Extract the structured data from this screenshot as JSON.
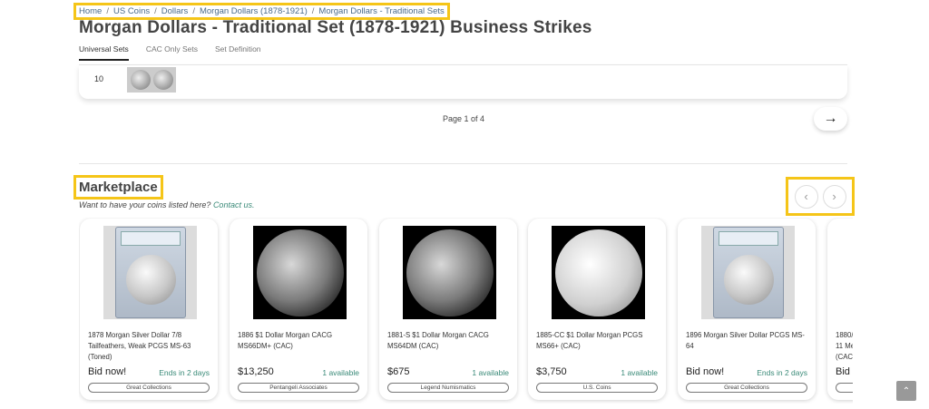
{
  "breadcrumb": [
    "Home",
    "US Coins",
    "Dollars",
    "Morgan Dollars (1878-1921)",
    "Morgan Dollars - Traditional Sets"
  ],
  "breadcrumb_sep": "/",
  "page_title": "Morgan Dollars - Traditional Set (1878-1921) Business Strikes",
  "tabs": [
    {
      "label": "Universal Sets",
      "active": true
    },
    {
      "label": "CAC Only Sets",
      "active": false
    },
    {
      "label": "Set Definition",
      "active": false
    }
  ],
  "table_row": {
    "number": "10"
  },
  "pagination": {
    "text": "Page 1 of 4",
    "next_glyph": "→"
  },
  "marketplace": {
    "title": "Marketplace",
    "subtitle": "Want to have your coins listed here?",
    "contact_link": "Contact us.",
    "prev_glyph": "‹",
    "next_glyph": "›"
  },
  "listings": [
    {
      "title": "1878 Morgan Silver Dollar 7/8 Tailfeathers, Weak PCGS MS-63 (Toned)",
      "price": "Bid now!",
      "availability": "Ends in 2 days",
      "seller": "Great Collections",
      "image": "slab"
    },
    {
      "title": "1886 $1 Dollar Morgan CACG MS66DM+ (CAC)",
      "price": "$13,250",
      "availability": "1 available",
      "seller": "Pentangeli Associates",
      "image": "dark"
    },
    {
      "title": "1881-S $1 Dollar Morgan CACG MS64DM (CAC)",
      "price": "$675",
      "availability": "1 available",
      "seller": "Legend Numismatics",
      "image": "dark"
    },
    {
      "title": "1885-CC $1 Dollar Morgan PCGS MS66+ (CAC)",
      "price": "$3,750",
      "availability": "1 available",
      "seller": "U.S. Coins",
      "image": "bright"
    },
    {
      "title": "1896 Morgan Silver Dollar PCGS MS-64",
      "price": "Bid now!",
      "availability": "Ends in 2 days",
      "seller": "Great Collections",
      "image": "slab"
    },
    {
      "title": "1880/ 11 Me (CAC",
      "price": "Bid",
      "availability": "",
      "seller": "",
      "image": "partial"
    }
  ],
  "scroll_top_glyph": "⌃"
}
